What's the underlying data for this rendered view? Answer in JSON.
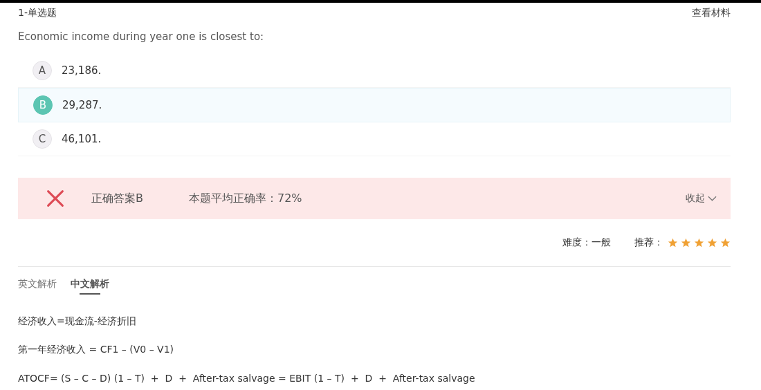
{
  "header": {
    "question_type": "1-单选题",
    "materials_link": "查看材料"
  },
  "question": "Economic income during year one is closest to:",
  "options": [
    {
      "letter": "A",
      "text": "23,186.",
      "selected": false
    },
    {
      "letter": "B",
      "text": "29,287.",
      "selected": true
    },
    {
      "letter": "C",
      "text": "46,101.",
      "selected": false
    }
  ],
  "result": {
    "correct": false,
    "answer": "正确答案B",
    "accuracy": "本题平均正确率：72%",
    "toggle": "收起",
    "expanded": true
  },
  "meta": {
    "difficulty": "难度：一般",
    "recommend_label": "推荐：",
    "stars": 5
  },
  "tabs": [
    {
      "label": "英文解析",
      "selected": false
    },
    {
      "label": "中文解析",
      "selected": true
    }
  ],
  "explanation": [
    "经济收入=现金流-经济折旧",
    "第一年经济收入 = CF1 – (V0 – V1)",
    "ATOCF= (S – C – D) (1 – T)  +  D  +  After-tax salvage = EBIT (1 – T)  +  D  +  After-tax salvage"
  ]
}
